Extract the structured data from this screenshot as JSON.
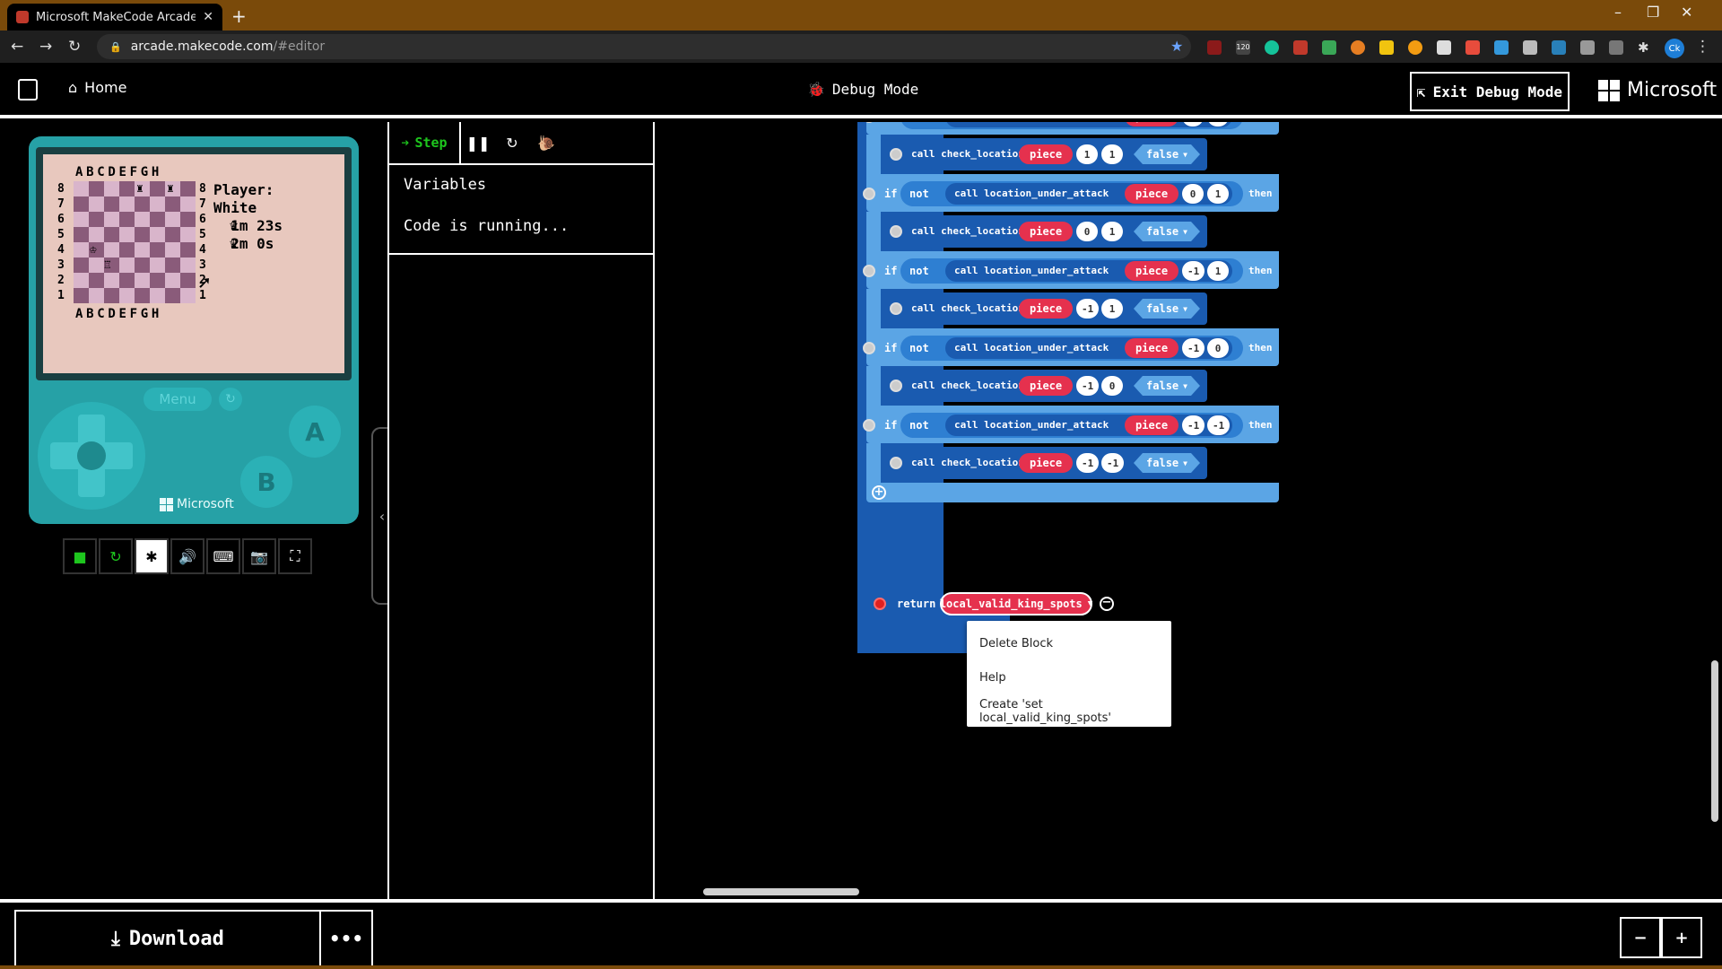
{
  "browser": {
    "tab_title": "Microsoft MakeCode Arcade",
    "url_host": "arcade.makecode.com",
    "url_path": "/#editor",
    "new_tab": "+",
    "ext_badge": "120",
    "profile_initials": "Ck"
  },
  "header": {
    "home_label": "Home",
    "debug_mode_label": "Debug Mode",
    "exit_debug_label": "Exit Debug Mode",
    "brand_label": "Microsoft"
  },
  "simulator": {
    "files": "ABCDEFGH",
    "ranks": [
      "8",
      "7",
      "6",
      "5",
      "4",
      "3",
      "2",
      "1"
    ],
    "player_text": "Player:\nWhite\n  1m 23s\n  2m 0s",
    "menu_label": "Menu",
    "a_label": "A",
    "b_label": "B",
    "brand_label": "Microsoft"
  },
  "debugger": {
    "step_label": "Step",
    "variables_label": "Variables",
    "status_text": "Code is running..."
  },
  "blocks": {
    "if_kw": "if",
    "not_kw": "not",
    "then_kw": "then",
    "attack_fn": "call location_under_attack",
    "check_fn": "call check_location",
    "piece_arg": "piece",
    "false_arg": "false",
    "rows": [
      {
        "a": "1",
        "b": "1"
      },
      {
        "a": "0",
        "b": "1"
      },
      {
        "a": "-1",
        "b": "1"
      },
      {
        "a": "-1",
        "b": "0"
      },
      {
        "a": "-1",
        "b": "-1"
      }
    ],
    "return_kw": "return",
    "return_var": "local_valid_king_spots"
  },
  "context_menu": {
    "items": [
      "Delete Block",
      "Help",
      "Create 'set local_valid_king_spots'"
    ]
  },
  "footer": {
    "download_label": "Download",
    "more_label": "•••",
    "zoom_out": "−",
    "zoom_in": "+"
  },
  "colors": {
    "if_block": "#5ba5e5",
    "call_block": "#1a5bb0",
    "piece_var": "#e5314e",
    "screen_bg": "#e8c8be",
    "console": "#26a1a6"
  }
}
